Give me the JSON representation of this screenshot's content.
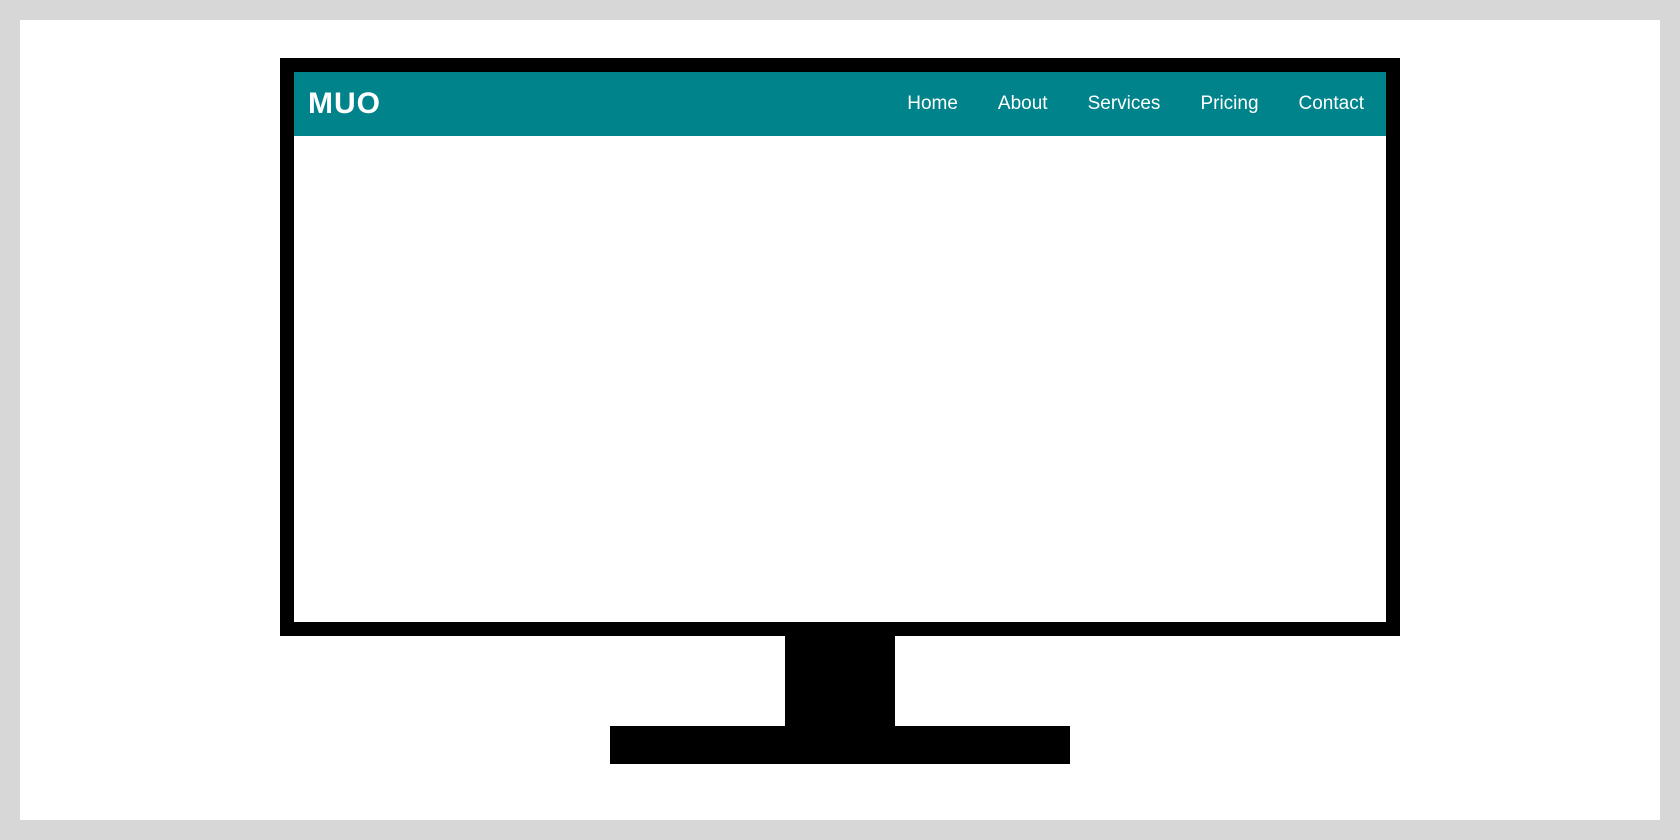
{
  "colors": {
    "navbar_bg": "#00838a",
    "navbar_text": "#ffffff",
    "page_bg": "#ffffff",
    "outer_bg": "#d7d7d7",
    "bezel": "#000000"
  },
  "logo": {
    "text": "MUO"
  },
  "nav": {
    "items": [
      {
        "label": "Home"
      },
      {
        "label": "About"
      },
      {
        "label": "Services"
      },
      {
        "label": "Pricing"
      },
      {
        "label": "Contact"
      }
    ]
  }
}
